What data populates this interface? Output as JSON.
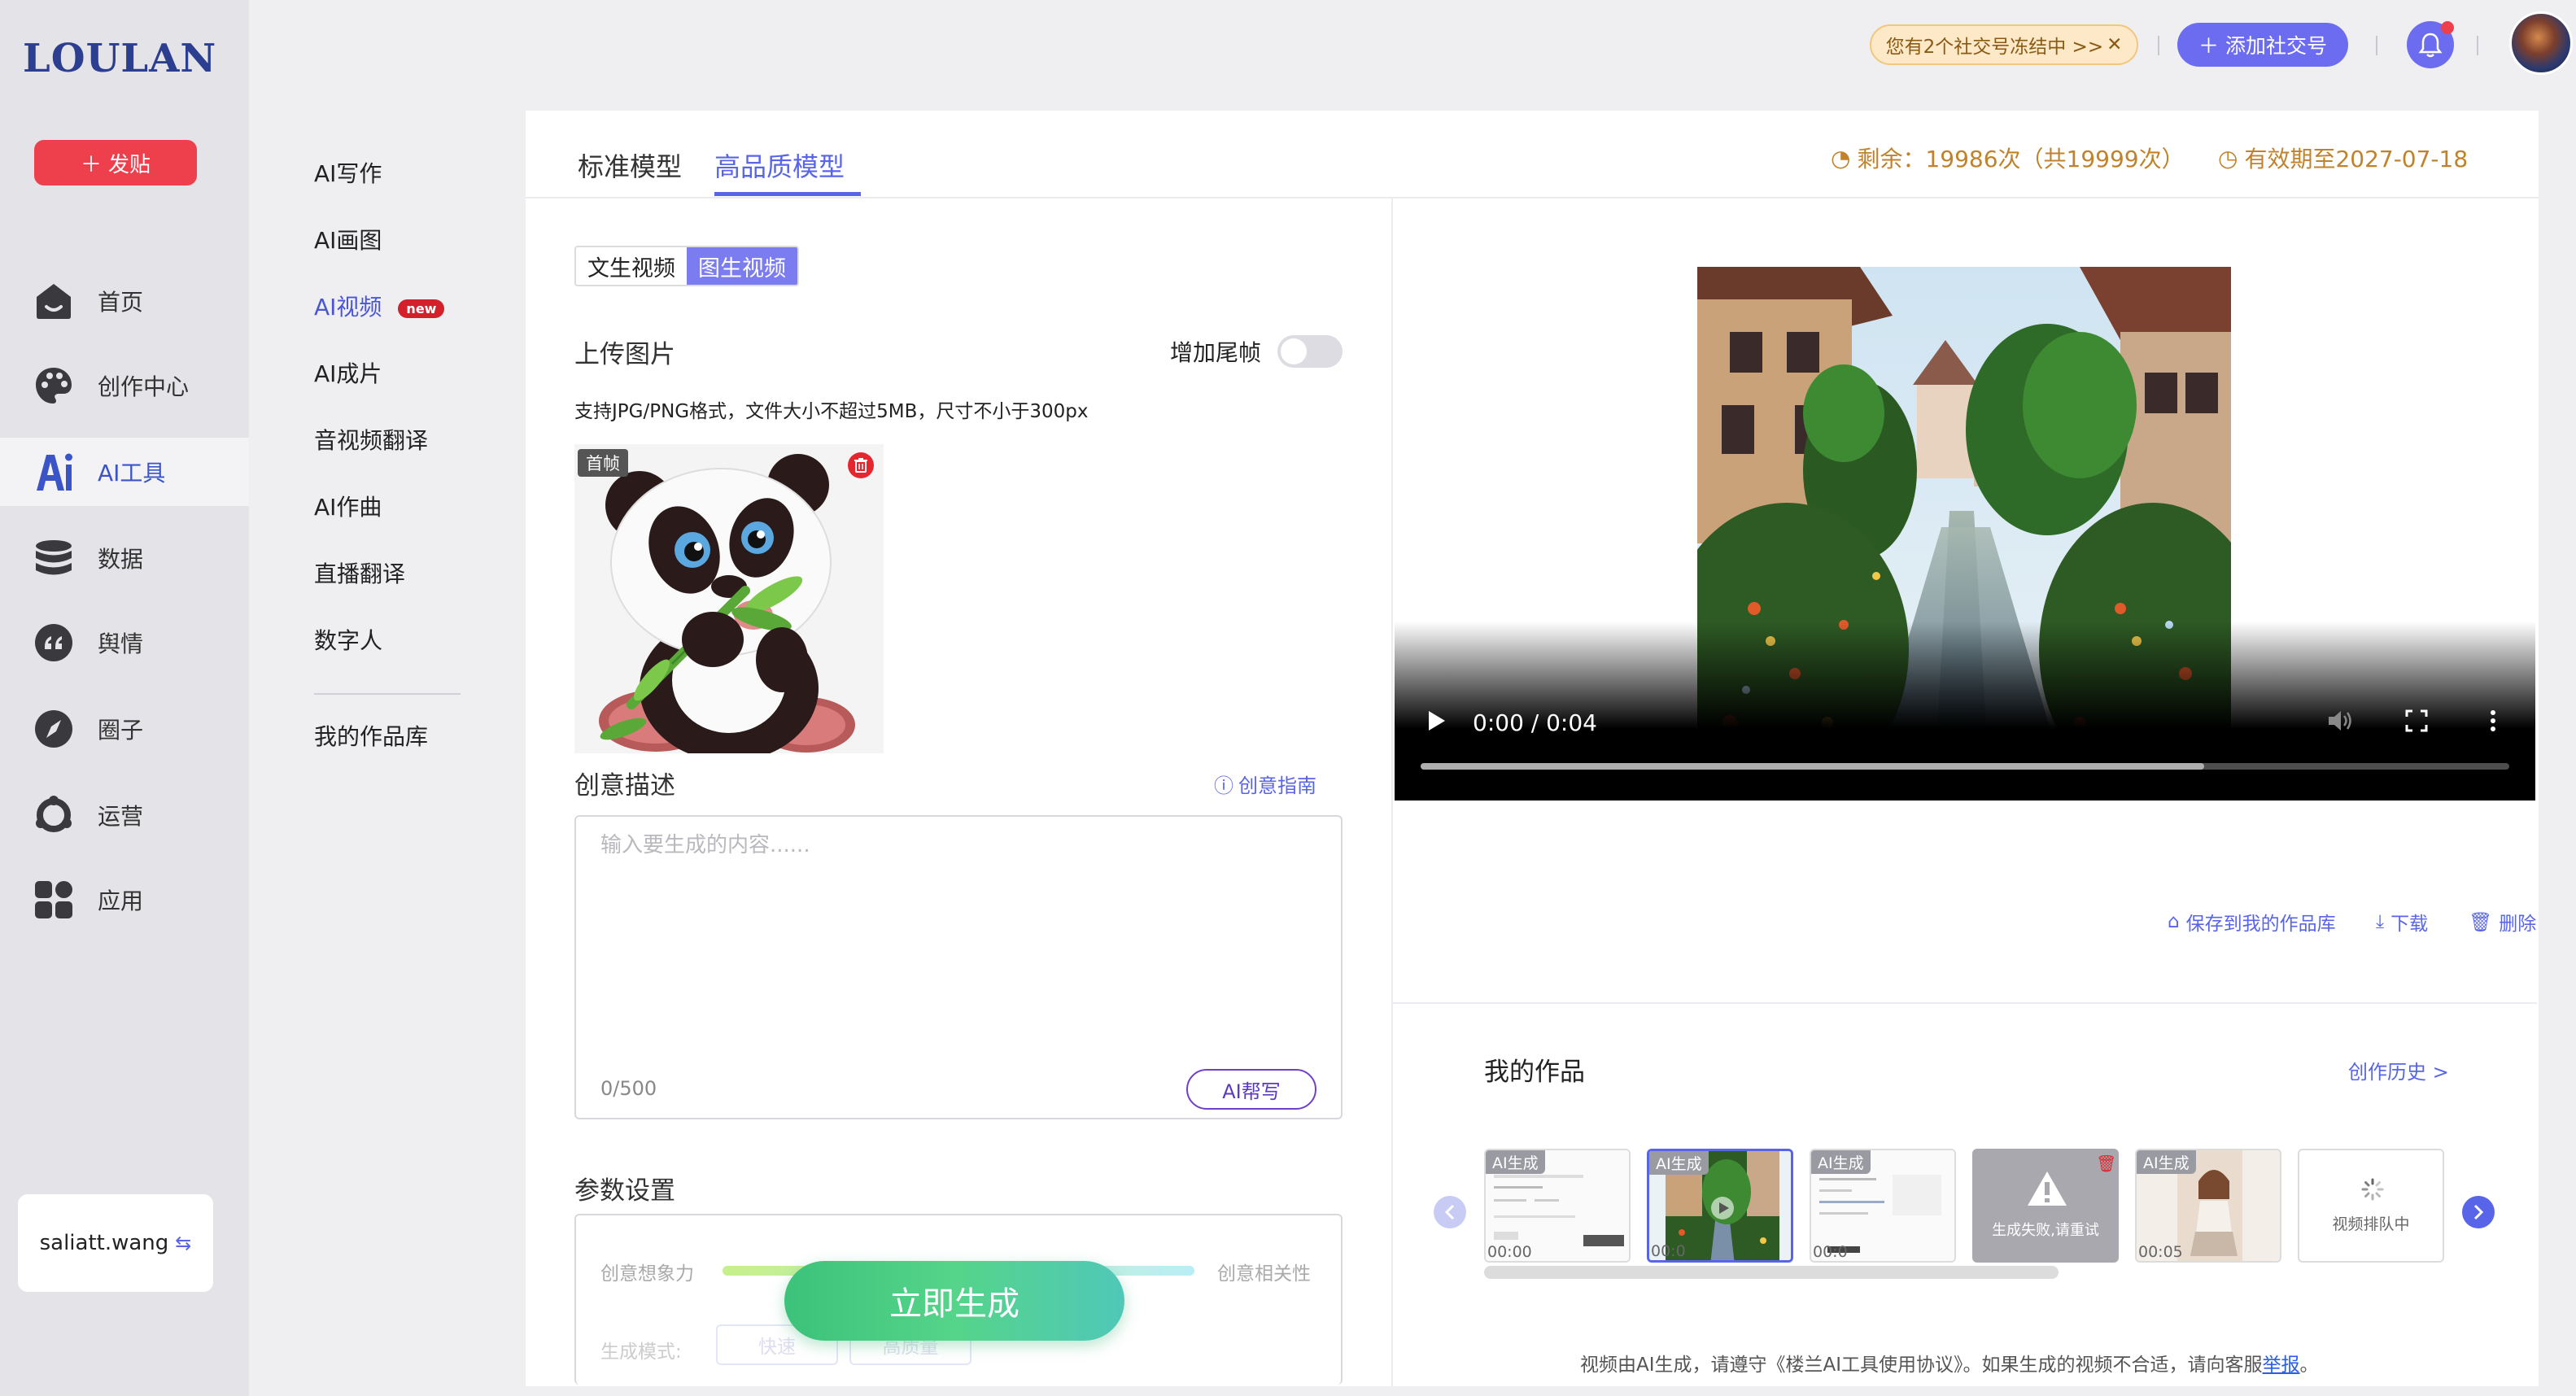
{
  "brand": {
    "logo_text": "LOULAN",
    "post_label": "发贴"
  },
  "leftnav": {
    "items": [
      {
        "label": "首页",
        "icon": "home-icon"
      },
      {
        "label": "创作中心",
        "icon": "palette-icon"
      },
      {
        "label": "AI工具",
        "icon": "ai-icon",
        "active": true
      },
      {
        "label": "数据",
        "icon": "database-icon"
      },
      {
        "label": "舆情",
        "icon": "quote-icon"
      },
      {
        "label": "圈子",
        "icon": "compass-icon"
      },
      {
        "label": "运营",
        "icon": "operation-icon"
      },
      {
        "label": "应用",
        "icon": "apps-icon"
      }
    ],
    "username": "saliatt.wang"
  },
  "subnav": {
    "items": [
      {
        "label": "AI写作"
      },
      {
        "label": "AI画图"
      },
      {
        "label": "AI视频",
        "badge": "new",
        "active": true
      },
      {
        "label": "AI成片"
      },
      {
        "label": "音视频翻译"
      },
      {
        "label": "AI作曲"
      },
      {
        "label": "直播翻译"
      },
      {
        "label": "数字人"
      }
    ],
    "library_label": "我的作品库"
  },
  "header": {
    "freeze_notice": "您有2个社交号冻结中 >>",
    "add_social": "添加社交号",
    "notification_icon": "bell-icon"
  },
  "tabs": {
    "items": [
      {
        "label": "标准模型"
      },
      {
        "label": "高品质模型",
        "active": true
      }
    ],
    "remaining": "剩余：19986次（共19999次）",
    "expiry": "有效期至2027-07-18"
  },
  "form": {
    "mode_options": [
      {
        "label": "文生视频"
      },
      {
        "label": "图生视频",
        "active": true
      }
    ],
    "upload_title": "上传图片",
    "end_frame_label": "增加尾帧",
    "end_frame_on": false,
    "upload_hint": "支持JPG/PNG格式，文件大小不超过5MB，尺寸不小于300px",
    "first_frame_tag": "首帧",
    "desc_title": "创意描述",
    "guide_label": "创意指南",
    "desc_placeholder": "输入要生成的内容......",
    "desc_counter": "0/500",
    "ai_write_label": "AI帮写",
    "params_title": "参数设置",
    "imagination_label": "创意想象力",
    "relevance_label": "创意相关性",
    "gen_mode_label": "生成模式:",
    "gen_modes": [
      "快速",
      "高质量"
    ],
    "generate_label": "立即生成"
  },
  "player": {
    "time": "0:00 / 0:04",
    "played_fraction": 0.0,
    "buffered_fraction": 0.72,
    "save_label": "保存到我的作品库",
    "download_label": "下载",
    "delete_label": "删除"
  },
  "works": {
    "title": "我的作品",
    "history_label": "创作历史 >",
    "items": [
      {
        "tag": "AI生成",
        "time": "00:00",
        "kind": "screenshot"
      },
      {
        "tag": "AI生成",
        "time": "00:0",
        "kind": "village",
        "selected": true
      },
      {
        "tag": "AI生成",
        "time": "00:0",
        "kind": "screenshot"
      },
      {
        "kind": "failed",
        "text": "生成失败,请重试"
      },
      {
        "tag": "AI生成",
        "time": "00:05",
        "kind": "girl"
      },
      {
        "kind": "queued",
        "text": "视频排队中"
      }
    ],
    "footer_text": "视频由AI生成，请遵守《楼兰AI工具使用协议》。如果生成的视频不合适，请向客服",
    "footer_link": "举报",
    "footer_end": "。"
  },
  "colors": {
    "accent": "#5865e8",
    "post_button": "#ee3f4d",
    "generate_start": "#3cc27a",
    "quota_text": "#c0822a"
  }
}
